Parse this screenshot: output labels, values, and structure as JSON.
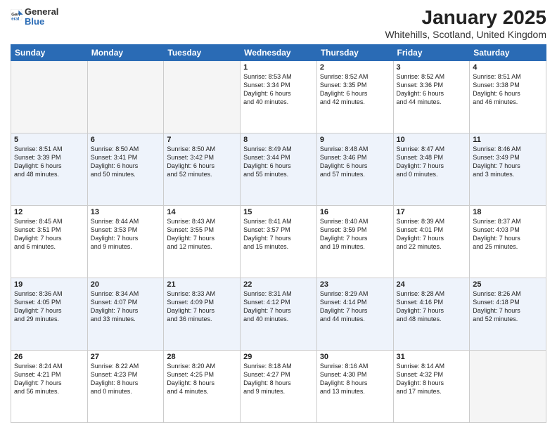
{
  "logo": {
    "text_general": "General",
    "text_blue": "Blue"
  },
  "header": {
    "title": "January 2025",
    "subtitle": "Whitehills, Scotland, United Kingdom"
  },
  "weekdays": [
    "Sunday",
    "Monday",
    "Tuesday",
    "Wednesday",
    "Thursday",
    "Friday",
    "Saturday"
  ],
  "weeks": [
    [
      {
        "day": "",
        "info": ""
      },
      {
        "day": "",
        "info": ""
      },
      {
        "day": "",
        "info": ""
      },
      {
        "day": "1",
        "info": "Sunrise: 8:53 AM\nSunset: 3:34 PM\nDaylight: 6 hours\nand 40 minutes."
      },
      {
        "day": "2",
        "info": "Sunrise: 8:52 AM\nSunset: 3:35 PM\nDaylight: 6 hours\nand 42 minutes."
      },
      {
        "day": "3",
        "info": "Sunrise: 8:52 AM\nSunset: 3:36 PM\nDaylight: 6 hours\nand 44 minutes."
      },
      {
        "day": "4",
        "info": "Sunrise: 8:51 AM\nSunset: 3:38 PM\nDaylight: 6 hours\nand 46 minutes."
      }
    ],
    [
      {
        "day": "5",
        "info": "Sunrise: 8:51 AM\nSunset: 3:39 PM\nDaylight: 6 hours\nand 48 minutes."
      },
      {
        "day": "6",
        "info": "Sunrise: 8:50 AM\nSunset: 3:41 PM\nDaylight: 6 hours\nand 50 minutes."
      },
      {
        "day": "7",
        "info": "Sunrise: 8:50 AM\nSunset: 3:42 PM\nDaylight: 6 hours\nand 52 minutes."
      },
      {
        "day": "8",
        "info": "Sunrise: 8:49 AM\nSunset: 3:44 PM\nDaylight: 6 hours\nand 55 minutes."
      },
      {
        "day": "9",
        "info": "Sunrise: 8:48 AM\nSunset: 3:46 PM\nDaylight: 6 hours\nand 57 minutes."
      },
      {
        "day": "10",
        "info": "Sunrise: 8:47 AM\nSunset: 3:48 PM\nDaylight: 7 hours\nand 0 minutes."
      },
      {
        "day": "11",
        "info": "Sunrise: 8:46 AM\nSunset: 3:49 PM\nDaylight: 7 hours\nand 3 minutes."
      }
    ],
    [
      {
        "day": "12",
        "info": "Sunrise: 8:45 AM\nSunset: 3:51 PM\nDaylight: 7 hours\nand 6 minutes."
      },
      {
        "day": "13",
        "info": "Sunrise: 8:44 AM\nSunset: 3:53 PM\nDaylight: 7 hours\nand 9 minutes."
      },
      {
        "day": "14",
        "info": "Sunrise: 8:43 AM\nSunset: 3:55 PM\nDaylight: 7 hours\nand 12 minutes."
      },
      {
        "day": "15",
        "info": "Sunrise: 8:41 AM\nSunset: 3:57 PM\nDaylight: 7 hours\nand 15 minutes."
      },
      {
        "day": "16",
        "info": "Sunrise: 8:40 AM\nSunset: 3:59 PM\nDaylight: 7 hours\nand 19 minutes."
      },
      {
        "day": "17",
        "info": "Sunrise: 8:39 AM\nSunset: 4:01 PM\nDaylight: 7 hours\nand 22 minutes."
      },
      {
        "day": "18",
        "info": "Sunrise: 8:37 AM\nSunset: 4:03 PM\nDaylight: 7 hours\nand 25 minutes."
      }
    ],
    [
      {
        "day": "19",
        "info": "Sunrise: 8:36 AM\nSunset: 4:05 PM\nDaylight: 7 hours\nand 29 minutes."
      },
      {
        "day": "20",
        "info": "Sunrise: 8:34 AM\nSunset: 4:07 PM\nDaylight: 7 hours\nand 33 minutes."
      },
      {
        "day": "21",
        "info": "Sunrise: 8:33 AM\nSunset: 4:09 PM\nDaylight: 7 hours\nand 36 minutes."
      },
      {
        "day": "22",
        "info": "Sunrise: 8:31 AM\nSunset: 4:12 PM\nDaylight: 7 hours\nand 40 minutes."
      },
      {
        "day": "23",
        "info": "Sunrise: 8:29 AM\nSunset: 4:14 PM\nDaylight: 7 hours\nand 44 minutes."
      },
      {
        "day": "24",
        "info": "Sunrise: 8:28 AM\nSunset: 4:16 PM\nDaylight: 7 hours\nand 48 minutes."
      },
      {
        "day": "25",
        "info": "Sunrise: 8:26 AM\nSunset: 4:18 PM\nDaylight: 7 hours\nand 52 minutes."
      }
    ],
    [
      {
        "day": "26",
        "info": "Sunrise: 8:24 AM\nSunset: 4:21 PM\nDaylight: 7 hours\nand 56 minutes."
      },
      {
        "day": "27",
        "info": "Sunrise: 8:22 AM\nSunset: 4:23 PM\nDaylight: 8 hours\nand 0 minutes."
      },
      {
        "day": "28",
        "info": "Sunrise: 8:20 AM\nSunset: 4:25 PM\nDaylight: 8 hours\nand 4 minutes."
      },
      {
        "day": "29",
        "info": "Sunrise: 8:18 AM\nSunset: 4:27 PM\nDaylight: 8 hours\nand 9 minutes."
      },
      {
        "day": "30",
        "info": "Sunrise: 8:16 AM\nSunset: 4:30 PM\nDaylight: 8 hours\nand 13 minutes."
      },
      {
        "day": "31",
        "info": "Sunrise: 8:14 AM\nSunset: 4:32 PM\nDaylight: 8 hours\nand 17 minutes."
      },
      {
        "day": "",
        "info": ""
      }
    ]
  ]
}
